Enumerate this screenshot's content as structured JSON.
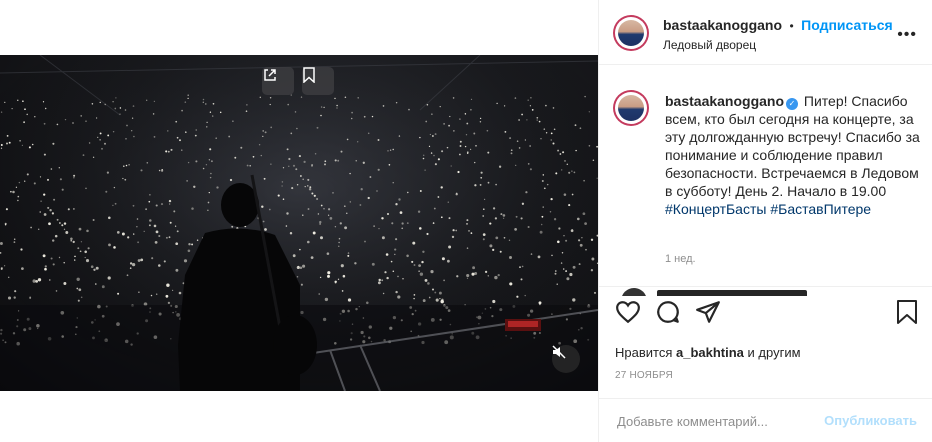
{
  "post": {
    "author": "bastaakanoggano",
    "separator": "•",
    "follow_label": "Подписаться",
    "location": "Ледовый дворец",
    "more_icon": "more-dots-icon"
  },
  "caption": {
    "author": "bastaakanoggano",
    "text": "Питер! Спасибо всем, кто был сегодня на концерте, за эту долгожданную встречу! Спасибо за понимание и соблюдение правил безопасности. Встречаемся в Ледовом в субботу! День 2. Начало в 19.00",
    "hashtags": [
      "#КонцертБасты",
      "#БаставПитере"
    ],
    "time": "1 нед."
  },
  "likes": {
    "prefix": "Нравится",
    "user": "a_bakhtina",
    "suffix": "и другим"
  },
  "date": "27 НОЯБРЯ",
  "comment": {
    "placeholder": "Добавьте комментарий...",
    "publish_label": "Опубликовать"
  },
  "colors": {
    "accent": "#0095f6",
    "publish_disabled": "#b2dffc",
    "hashtag": "#00376b",
    "verified": "#3897f0"
  }
}
